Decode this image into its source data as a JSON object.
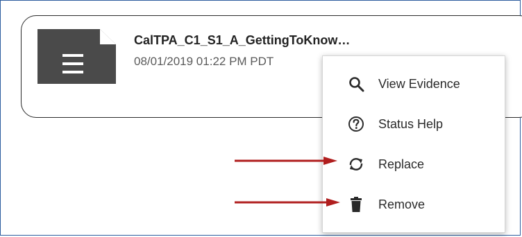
{
  "file": {
    "name": "CalTPA_C1_S1_A_GettingToKnow…",
    "date": "08/01/2019 01:22 PM PDT",
    "icon": "document-icon"
  },
  "menu": {
    "items": [
      {
        "label": "View Evidence",
        "icon": "search-icon"
      },
      {
        "label": "Status Help",
        "icon": "question-circle-icon"
      },
      {
        "label": "Replace",
        "icon": "replace-icon"
      },
      {
        "label": "Remove",
        "icon": "trash-icon"
      }
    ]
  },
  "colors": {
    "arrow": "#b01e1e",
    "icon_dark": "#4a4a4a",
    "frame_border": "#2b5c9e"
  }
}
